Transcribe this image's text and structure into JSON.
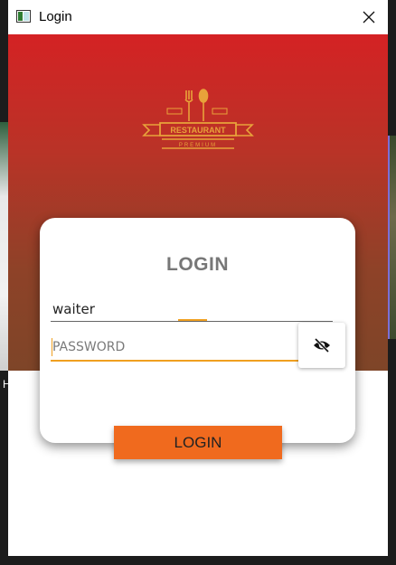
{
  "window": {
    "title": "Login"
  },
  "logo": {
    "brand": "RESTAURANT",
    "tagline": "PREMIUM"
  },
  "form": {
    "heading": "LOGIN",
    "username_value": "waiter",
    "password_placeholder": "PASSWORD",
    "submit_label": "LOGIN"
  },
  "background": {
    "left_fragment_text": "H"
  },
  "colors": {
    "hero_top": "#d42224",
    "hero_bottom": "#7e4528",
    "accent": "#f0a020",
    "button": "#f06a1e",
    "logo_gold": "#e8a23a"
  },
  "icons": {
    "close": "close-icon",
    "toggle_visibility": "eye-off-icon",
    "app": "app-icon"
  }
}
